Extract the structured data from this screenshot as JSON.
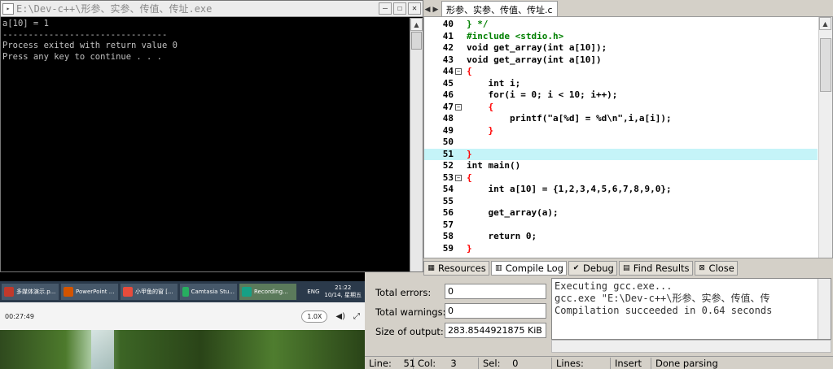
{
  "console": {
    "title": "E:\\Dev-c++\\形参、实参、传值、传址.exe",
    "lines": [
      "a[10] = 1",
      "",
      "--------------------------------",
      "Process exited with return value 0",
      "Press any key to continue . . ."
    ]
  },
  "editor": {
    "tab_label": "形参、实参、传值、传址.c",
    "highlight_line": 51,
    "lines": [
      {
        "n": "40",
        "text": "} */",
        "color": "#008000",
        "fold": ""
      },
      {
        "n": "41",
        "text": "#include <stdio.h>",
        "color": "#008000",
        "fold": ""
      },
      {
        "n": "42",
        "text": "void get_array(int a[10]);",
        "color": "#000000",
        "fold": ""
      },
      {
        "n": "43",
        "text": "void get_array(int a[10])",
        "color": "#000000",
        "fold": ""
      },
      {
        "n": "44",
        "text": "{",
        "color": "#ff0000",
        "fold": "-"
      },
      {
        "n": "45",
        "text": "    int i;",
        "color": "#000000",
        "fold": ""
      },
      {
        "n": "46",
        "text": "    for(i = 0; i < 10; i++);",
        "color": "#000000",
        "fold": ""
      },
      {
        "n": "47",
        "text": "    {",
        "color": "#ff0000",
        "fold": "-"
      },
      {
        "n": "48",
        "text": "        printf(\"a[%d] = %d\\n\",i,a[i]);",
        "color": "#000000",
        "fold": ""
      },
      {
        "n": "49",
        "text": "    }",
        "color": "#ff0000",
        "fold": ""
      },
      {
        "n": "50",
        "text": "",
        "color": "#000000",
        "fold": ""
      },
      {
        "n": "51",
        "text": "}",
        "color": "#ff0000",
        "fold": ""
      },
      {
        "n": "52",
        "text": "int main()",
        "color": "#000000",
        "fold": ""
      },
      {
        "n": "53",
        "text": "{",
        "color": "#ff0000",
        "fold": "-"
      },
      {
        "n": "54",
        "text": "    int a[10] = {1,2,3,4,5,6,7,8,9,0};",
        "color": "#000000",
        "fold": ""
      },
      {
        "n": "55",
        "text": "",
        "color": "#000000",
        "fold": ""
      },
      {
        "n": "56",
        "text": "    get_array(a);",
        "color": "#000000",
        "fold": ""
      },
      {
        "n": "57",
        "text": "",
        "color": "#000000",
        "fold": ""
      },
      {
        "n": "58",
        "text": "    return 0;",
        "color": "#000000",
        "fold": ""
      },
      {
        "n": "59",
        "text": "}",
        "color": "#ff0000",
        "fold": ""
      }
    ]
  },
  "bottom_tabs": [
    {
      "label": "Resources",
      "icon": "grid-icon",
      "glyph": "▦"
    },
    {
      "label": "Compile Log",
      "icon": "chart-icon",
      "glyph": "▥"
    },
    {
      "label": "Debug",
      "icon": "check-icon",
      "glyph": "✔"
    },
    {
      "label": "Find Results",
      "icon": "find-icon",
      "glyph": "▤"
    },
    {
      "label": "Close",
      "icon": "close-icon",
      "glyph": "⊠"
    }
  ],
  "stats": {
    "errors_label": "Total errors:",
    "errors_value": "0",
    "warnings_label": "Total warnings:",
    "warnings_value": "0",
    "size_label": "Size of output:",
    "size_value": "283.8544921875 KiB"
  },
  "log": [
    "Executing gcc.exe...",
    "gcc.exe \"E:\\Dev-c++\\形参、实参、传值、传",
    "Compilation succeeded in 0.64 seconds"
  ],
  "status": {
    "line_label": "Line:",
    "line_value": "51",
    "col_label": "Col:",
    "col_value": "3",
    "sel_label": "Sel:",
    "sel_value": "0",
    "lines_label": "Lines:",
    "lines_value": "",
    "mode": "Insert",
    "message": "Done parsing"
  },
  "taskbar": {
    "items": [
      {
        "label": "多媒体演示.p...",
        "color": "#c0392b"
      },
      {
        "label": "PowerPoint ...",
        "color": "#d35400"
      },
      {
        "label": "小甲鱼的窗 [...",
        "color": "#e74c3c"
      },
      {
        "label": "Camtasia Stu...",
        "color": "#27ae60"
      },
      {
        "label": "Recording...",
        "color": "#16a085"
      }
    ],
    "lang": "ENG",
    "time": "21:22",
    "date": "10/14, 星期五"
  },
  "player": {
    "time": "00:27:49",
    "speed": "1.0X"
  }
}
